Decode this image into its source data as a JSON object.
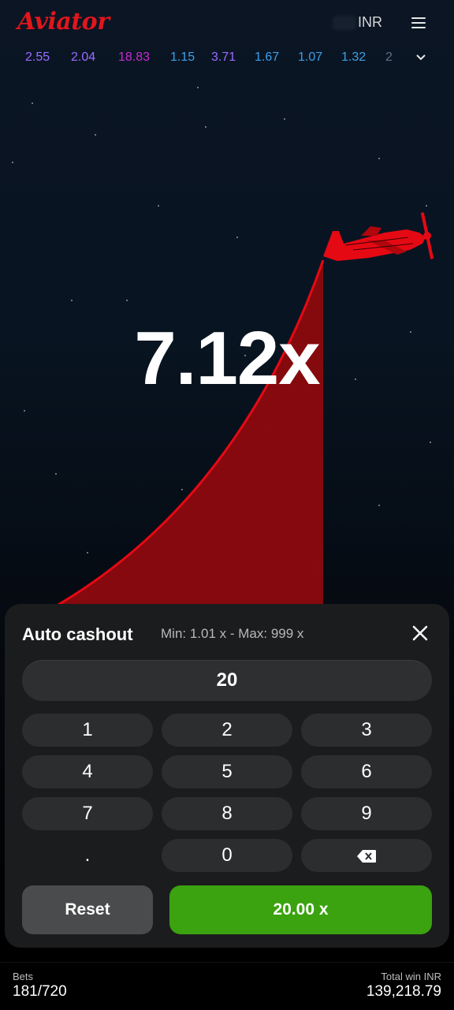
{
  "header": {
    "logo": "Aviator",
    "currency": "INR",
    "menu_icon": "hamburger-menu-icon"
  },
  "history": {
    "multipliers": [
      {
        "value": "2.55",
        "color": "#9b6bff"
      },
      {
        "value": "2.04",
        "color": "#9b6bff"
      },
      {
        "value": "18.83",
        "color": "#c72bd1"
      },
      {
        "value": "1.15",
        "color": "#3c9fe6"
      },
      {
        "value": "3.71",
        "color": "#9b6bff"
      },
      {
        "value": "1.67",
        "color": "#3c9fe6"
      },
      {
        "value": "1.07",
        "color": "#3c9fe6"
      },
      {
        "value": "1.32",
        "color": "#3c9fe6"
      },
      {
        "value": "2",
        "color": "#5a6f8a"
      }
    ],
    "expand_icon": "chevron-down-icon"
  },
  "game": {
    "current_multiplier": "7.12x",
    "curve_color": "#e50914",
    "plane_icon": "airplane-icon"
  },
  "auto_cashout": {
    "title": "Auto cashout",
    "range": "Min: 1.01 x - Max: 999 x",
    "close_icon": "close-icon",
    "value": "20",
    "keys": [
      "1",
      "2",
      "3",
      "4",
      "5",
      "6",
      "7",
      "8",
      "9",
      ".",
      "0"
    ],
    "backspace_icon": "backspace-icon",
    "reset_label": "Reset",
    "confirm_label": "20.00 x",
    "confirm_color": "#3aa30f"
  },
  "footer": {
    "bets_label": "Bets",
    "bets_value": "181/720",
    "total_win_label": "Total win INR",
    "total_win_value": "139,218.79"
  }
}
